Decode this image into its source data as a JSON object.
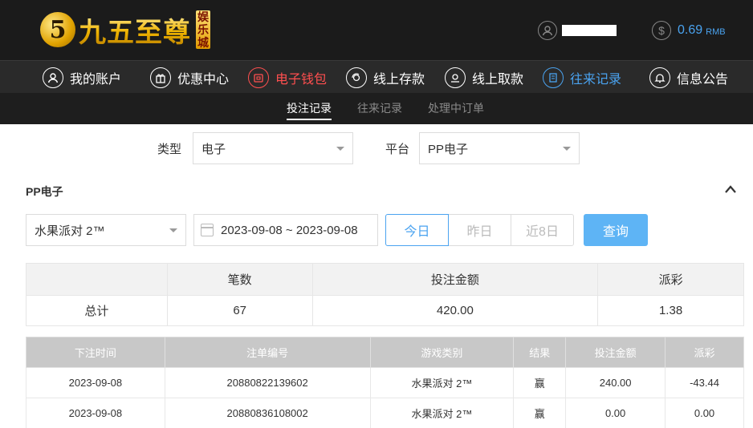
{
  "brand": {
    "mark": "5",
    "name": "九五至尊",
    "badge": "娱乐城"
  },
  "header": {
    "username": "",
    "balance": "0.69",
    "currency": "RMB"
  },
  "nav": {
    "items": [
      {
        "label": "我的账户",
        "icon": "user-icon"
      },
      {
        "label": "优惠中心",
        "icon": "gift-icon"
      },
      {
        "label": "电子钱包",
        "icon": "wallet-icon"
      },
      {
        "label": "线上存款",
        "icon": "deposit-icon"
      },
      {
        "label": "线上取款",
        "icon": "withdraw-icon"
      },
      {
        "label": "往来记录",
        "icon": "records-icon"
      },
      {
        "label": "信息公告",
        "icon": "bell-icon"
      }
    ]
  },
  "subnav": {
    "items": [
      {
        "label": "投注记录"
      },
      {
        "label": "往来记录"
      },
      {
        "label": "处理中订单"
      }
    ]
  },
  "filters": {
    "type_label": "类型",
    "type_value": "电子",
    "platform_label": "平台",
    "platform_value": "PP电子"
  },
  "section": {
    "title": "PP电子",
    "game_value": "水果派对 2™",
    "date_range": "2023-09-08 ~ 2023-09-08",
    "quick": [
      "今日",
      "昨日",
      "近8日"
    ],
    "query_label": "查询"
  },
  "summary": {
    "headers": [
      "",
      "笔数",
      "投注金额",
      "派彩"
    ],
    "row": {
      "label": "总计",
      "count": "67",
      "amount": "420.00",
      "payout": "1.38"
    }
  },
  "details": {
    "headers": [
      "下注时间",
      "注单编号",
      "游戏类别",
      "结果",
      "投注金额",
      "派彩"
    ],
    "rows": [
      {
        "time": "2023-09-08",
        "id": "20880822139602",
        "game": "水果派对 2™",
        "result": "赢",
        "amount": "240.00",
        "payout": "-43.44"
      },
      {
        "time": "2023-09-08",
        "id": "20880836108002",
        "game": "水果派对 2™",
        "result": "赢",
        "amount": "0.00",
        "payout": "0.00"
      }
    ]
  },
  "colors": {
    "accent_blue": "#4aa3f0",
    "accent_red": "#ff4f4f",
    "negative": "#e8343a",
    "gold": "#f0b400"
  }
}
